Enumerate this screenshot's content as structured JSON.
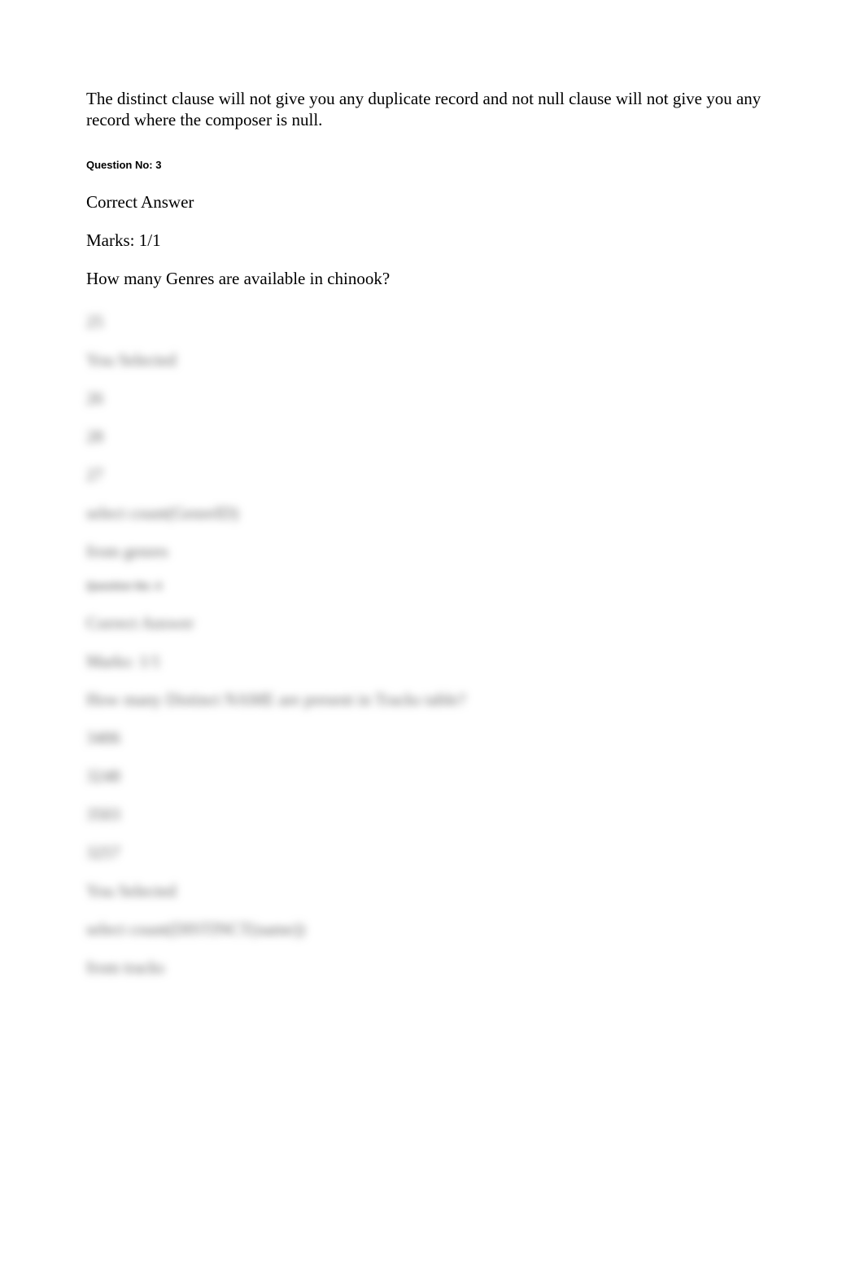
{
  "intro": "The distinct clause will not give you any duplicate record and not null clause will not give you any record where the composer is null.",
  "q3": {
    "header": "Question No: 3",
    "correct": "Correct Answer",
    "marks": "Marks: 1/1",
    "question": "How many Genres are available in chinook?",
    "options": [
      "25",
      "26",
      "28",
      "27"
    ],
    "you_selected": "You Selected",
    "sql1": "select count(GenreID)",
    "sql2": "from genres",
    "next_header": "Question No: 4",
    "next_correct": "Correct Answer",
    "next_marks": "Marks: 1/1",
    "next_question": "How many Distinct NAME are present in Tracks table?",
    "next_options": [
      "3406",
      "3248",
      "3503",
      "3257"
    ],
    "next_you_selected": "You Selected",
    "next_sql1": "select count(DISTINCT(name))",
    "next_sql2": "from tracks"
  }
}
